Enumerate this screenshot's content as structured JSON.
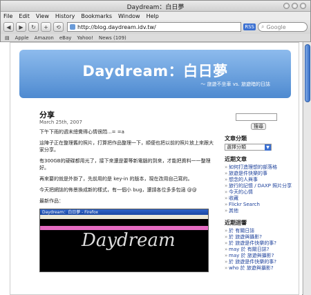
{
  "window": {
    "title": "Daydream：白日夢"
  },
  "menu": [
    "File",
    "Edit",
    "View",
    "History",
    "Bookmarks",
    "Window",
    "Help"
  ],
  "toolbar": {
    "url": "http://blog.daydream.idv.tw/",
    "rss": "RSS",
    "search_placeholder": "Google"
  },
  "bookmarks": [
    "Apple",
    "Amazon",
    "eBay",
    "Yahoo!",
    "News (109)"
  ],
  "blog": {
    "title": "Daydream：白日夢",
    "subtitle": "～ 旅遊不坐車 vs. 旅遊暗的日誌"
  },
  "post": {
    "title": "分享",
    "date": "March 25th, 2007",
    "lines": [
      "下午下雨的週末總覺得心情很悶...= =a",
      "這陣子正在整理舊的照片，打算把作品整理一下，順便也把以前的照片放上來跟大家分享。",
      "有300GB的硬碟都用光了，接下來還是要等新電腦的到來，才能把資料一一整理好。",
      "再來要的就是外掛了，先前用的是 key-in 的版本，現在改用自己寫的。",
      "今天把網誌的佈景換成新的樣式，有一個小 bug，還請各位多多包涵 @@",
      "最新作品："
    ],
    "screenshot_title": "Daydream：白日夢 - Firefox",
    "screenshot_logo": "Daydream"
  },
  "sidebar": {
    "search_button": "搜尋",
    "archives_heading": "文章分類",
    "archives_select": "選擇分類",
    "recent_heading": "近期文章",
    "recent": [
      "如何打造理想的部落格",
      "旅遊是件快樂的事",
      "想念的人與事",
      "旅行的記憶 / DAXP 照片分享",
      "今天的心情",
      "收藏",
      "Flickr Search",
      "其他"
    ],
    "comments_heading": "近期迴響",
    "comments": [
      "於 有關日誌",
      "於 旅遊與攝影?",
      "於 旅遊是件快樂的事?",
      "may 於 有關日誌?",
      "may 於 旅遊與攝影?",
      "於 旅遊是件快樂的事?",
      "who 於 旅遊與攝影?"
    ]
  }
}
